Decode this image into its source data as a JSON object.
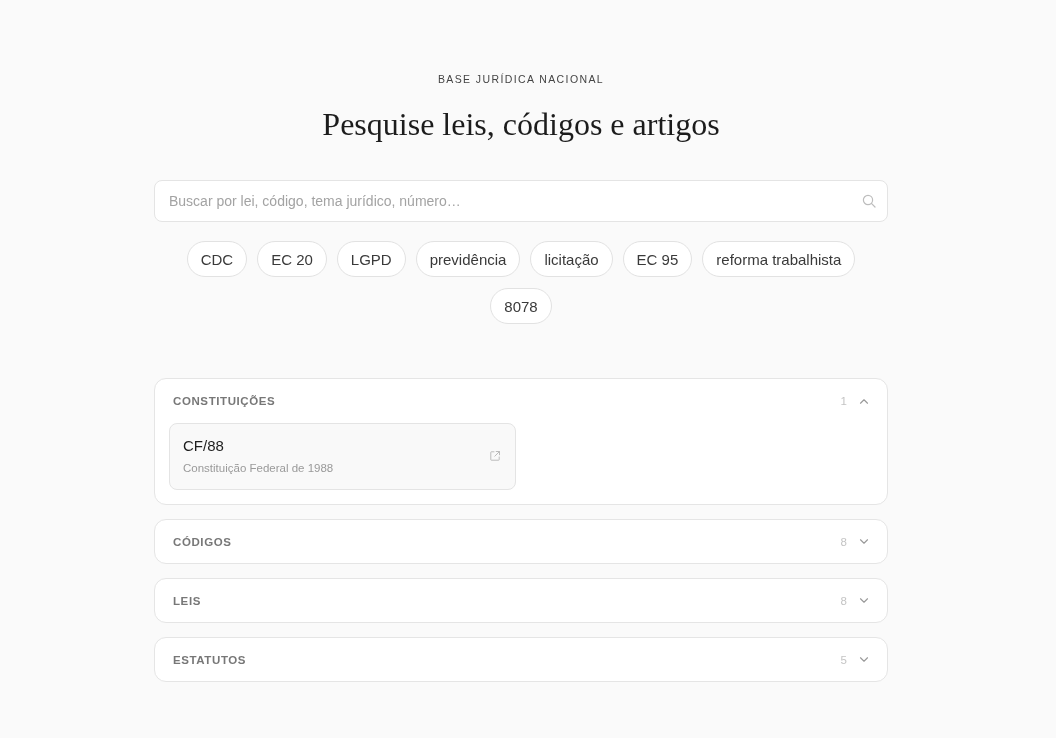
{
  "header": {
    "eyebrow": "BASE JURÍDICA NACIONAL",
    "title": "Pesquise leis, códigos e artigos"
  },
  "search": {
    "placeholder": "Buscar por lei, código, tema jurídico, número…"
  },
  "chips": [
    "CDC",
    "EC 20",
    "LGPD",
    "previdência",
    "licitação",
    "EC 95",
    "reforma trabalhista",
    "8078"
  ],
  "sections": [
    {
      "title": "CONSTITUIÇÕES",
      "count": "1",
      "expanded": true,
      "items": [
        {
          "code": "CF/88",
          "name": "Constituição Federal de 1988"
        }
      ]
    },
    {
      "title": "CÓDIGOS",
      "count": "8",
      "expanded": false
    },
    {
      "title": "LEIS",
      "count": "8",
      "expanded": false
    },
    {
      "title": "ESTATUTOS",
      "count": "5",
      "expanded": false
    }
  ]
}
